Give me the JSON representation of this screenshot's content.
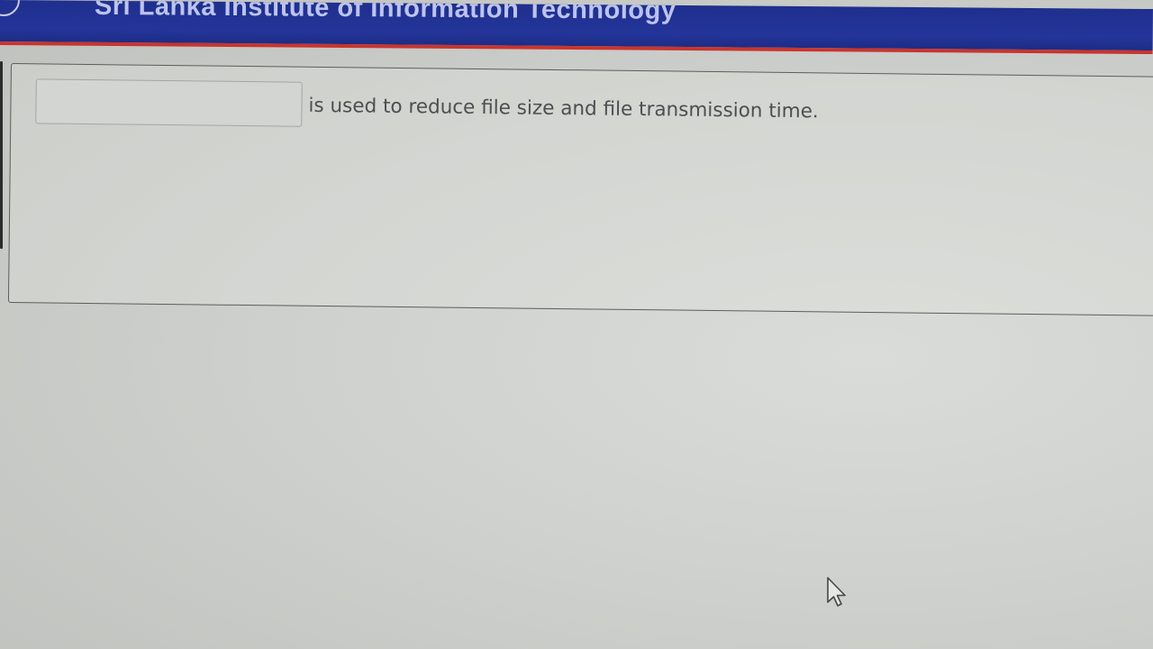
{
  "header": {
    "title": "Sri Lanka Institute of Information Technology",
    "logo_icon": "university-crest-icon",
    "background_color": "#22339a",
    "accent_color": "#c8352e"
  },
  "question": {
    "answer_value": "",
    "text": "is used to reduce file size and file transmission time."
  },
  "pointer": {
    "icon": "mouse-pointer-icon"
  }
}
